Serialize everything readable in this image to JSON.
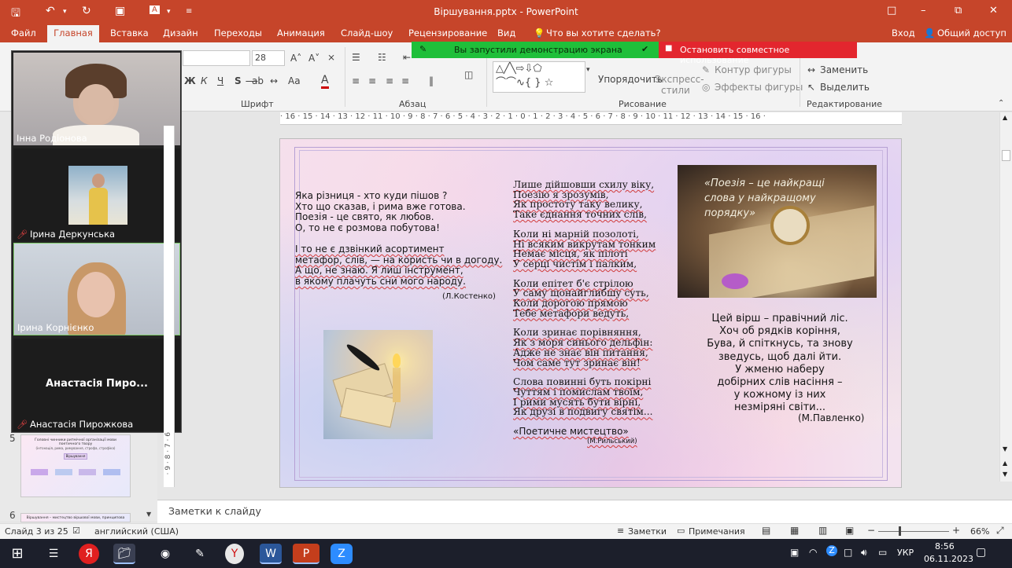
{
  "title_bar": {
    "document_title": "Віршування.pptx - PowerPoint"
  },
  "menu": {
    "items": [
      "Файл",
      "Главная",
      "Вставка",
      "Дизайн",
      "Переходы",
      "Анимация",
      "Слайд-шоу",
      "Рецензирование",
      "Вид"
    ],
    "search_placeholder": "Что вы хотите сделать?",
    "signin": "Вход",
    "share": "Общий доступ"
  },
  "ribbon": {
    "groups": [
      "Шрифт",
      "Абзац",
      "Рисование",
      "Редактирование"
    ],
    "font_size": "28",
    "arrange": "Упорядочить",
    "express_styles": [
      "Экспресс-",
      "стили"
    ],
    "shape_outline": "Контур фигуры",
    "shape_effects": "Эффекты фигуры",
    "replace": "Заменить",
    "select": "Выделить",
    "bold": "Ж",
    "italic": "К",
    "underline": "Ч",
    "strike": "S",
    "case": "Аа",
    "font_color": "А"
  },
  "screen_share": {
    "notice": "Вы запустили демонстрацию экрана",
    "stop": "Остановить совместное использование"
  },
  "ruler": {
    "ticks": "· 16 · 15 · 14 · 13 · 12 · 11 · 10 · 9 · 8 · 7 · 6 · 5 · 4 · 3 · 2 · 1 · 0 · 1 · 2 · 3 · 4 · 5 · 6 · 7 · 8 · 9 · 10 · 11 · 12 · 13 · 14 · 15 · 16 ·",
    "vticks": "· 9 · 8 · 7 · 6"
  },
  "participants": [
    {
      "name": "Інна Родіонова",
      "muted": false
    },
    {
      "name": "Ірина Деркунська",
      "muted": true
    },
    {
      "name": "Ірина Корнієнко",
      "muted": false
    },
    {
      "name": "Анастасія Пирожкова",
      "muted": true,
      "display": "Анастасія  Пиро..."
    }
  ],
  "thumbnails": {
    "num5": "5",
    "num6": "6",
    "slide5_title": "Головні чинники ритмічної організації мови поетичного твору",
    "slide5_sub": "(інтонація, рима, римування, строфа, строфіка)",
    "slide5_box": "Віршування",
    "slide6_title": "Віршування – мистецтво віршової мови, принципова"
  },
  "slide": {
    "left_poem": [
      "Яка різниця - хто куди пішов ?",
      "Хто що сказав, і рима вже готова.",
      "Поезія - це свято, як любов.",
      "О, то не є розмова побутова!",
      "",
      "І то не є дзвінкий асортимент",
      "метафор, слів, — на користь чи в догоду.",
      "А що, не знаю. Я лиш інструмент,",
      "в якому плачуть сни мого народу."
    ],
    "left_author": "(Л.Костенко)",
    "middle_stanzas": [
      [
        "Лише дійшовши схилу віку,",
        "Поезію я зрозумів,",
        "Як простоту таку велику,",
        "Таке єднання точних слів,"
      ],
      [
        "Коли ні марній позолоті,",
        "Ні всяким викрутам тонким",
        "Немає місця, як пілоті",
        "У серці чистім і палким,"
      ],
      [
        "Коли епітет б'є стрілою",
        "У саму щонайглибшу суть,",
        "Коли дорогою прямою",
        "Тебе метафори ведуть,"
      ],
      [
        "Коли зринає порівняння,",
        "Як з моря синього дельфін:",
        "Адже не знає він питання,",
        "Чом саме тут зринає він!"
      ],
      [
        "Слова повинні буть покірні",
        "Чуттям і помислам твоїм,",
        "І рими мусять бути вірні,",
        "Як друзі в подвигу святім..."
      ]
    ],
    "middle_title": "«Поетичне мистецтво»",
    "middle_author": "(М.Рильський)",
    "quote": "«Поезія – це найкращі слова у найкращому порядку»",
    "right_poem": [
      "Цей вірш – правічний ліс.",
      "Хоч об рядків коріння,",
      "Бува, й спіткнусь, та знову",
      "зведусь, щоб далі йти.",
      "У жменю наберу",
      "добірних слів насіння –",
      "у кожному із них",
      "незміряні світи..."
    ],
    "right_author": "(М.Павленко)"
  },
  "notes": {
    "placeholder": "Заметки к слайду"
  },
  "status": {
    "slide": "Слайд 3 из 25",
    "lang": "английский (США)",
    "notes": "Заметки",
    "comments": "Примечания",
    "zoom": "66%",
    "zoom_minus": "−",
    "zoom_plus": "+"
  },
  "taskbar": {
    "time": "8:56",
    "date": "06.11.2023",
    "lang": "УКР"
  }
}
